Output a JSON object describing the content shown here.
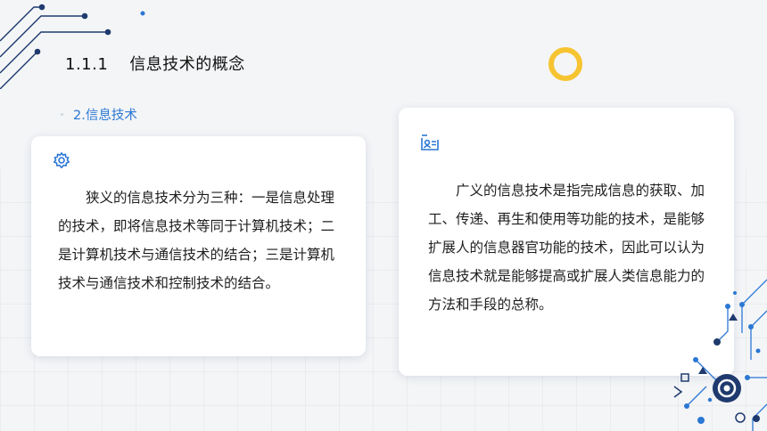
{
  "page": {
    "section_number": "1.1.1",
    "title": "信息技术的概念",
    "subtitle": "2.信息技术"
  },
  "cards": [
    {
      "icon": "gear-icon",
      "text": "狭义的信息技术分为三种：一是信息处理的技术，即将信息技术等同于计算机技术；二是计算机技术与通信技术的结合；三是计算机技术与通信技术和控制技术的结合。"
    },
    {
      "icon": "id-card-icon",
      "text": "广义的信息技术是指完成信息的获取、加工、传递、再生和使用等功能的技术，是能够扩展人的信息器官功能的技术，因此可以认为信息技术就是能够提高或扩展人类信息能力的方法和手段的总称。"
    }
  ],
  "colors": {
    "accent_blue": "#2b77d4",
    "circuit_navy": "#1f3a6e",
    "ring_yellow": "#f6c431",
    "background": "#f4f5f7"
  }
}
